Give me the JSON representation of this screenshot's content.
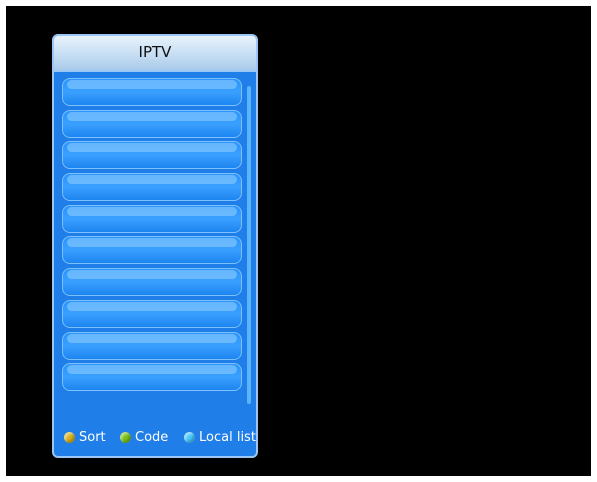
{
  "title": "IPTV",
  "list": {
    "rows": [
      "",
      "",
      "",
      "",
      "",
      "",
      "",
      "",
      "",
      ""
    ]
  },
  "footer": {
    "sort": {
      "label": "Sort",
      "color": "#d8b21e"
    },
    "code": {
      "label": "Code",
      "color": "#7cc21b"
    },
    "local": {
      "label": "Local list",
      "color": "#46c7ff"
    }
  }
}
